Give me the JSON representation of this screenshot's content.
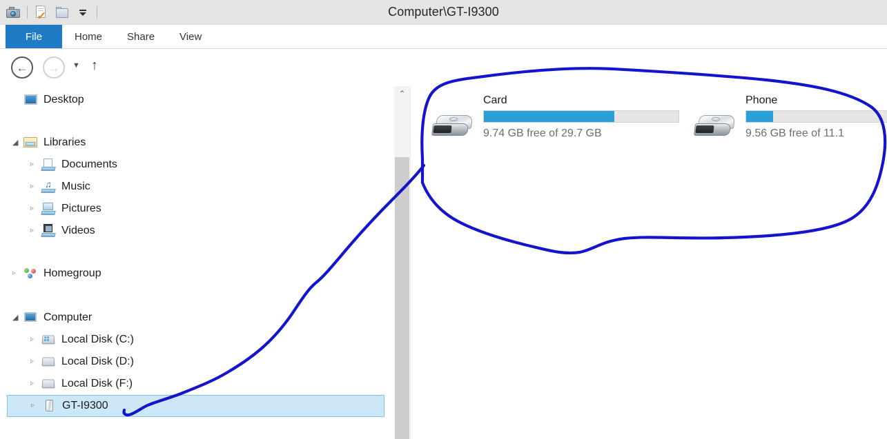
{
  "window": {
    "title": "Computer\\GT-I9300",
    "quick_access": [
      {
        "name": "device-camera-icon",
        "label": "GT-I9300"
      },
      {
        "name": "properties-icon",
        "label": "Properties"
      },
      {
        "name": "new-folder-icon",
        "label": "New folder"
      },
      {
        "name": "customize-dropdown-icon",
        "label": "Customize Quick Access Toolbar"
      }
    ]
  },
  "ribbon": {
    "tabs": [
      {
        "label": "File",
        "active": true
      },
      {
        "label": "Home",
        "active": false
      },
      {
        "label": "Share",
        "active": false
      },
      {
        "label": "View",
        "active": false
      }
    ]
  },
  "navigation": {
    "back_glyph": "←",
    "forward_glyph": "→",
    "history_glyph": "▼",
    "up_glyph": "↑",
    "breadcrumb": {
      "icon": "device-camera-icon",
      "separator": "▸",
      "items": [
        "Computer",
        "GT-I9300"
      ]
    }
  },
  "sidebar": {
    "items": [
      {
        "label": "Desktop",
        "icon": "desktop-icon",
        "indent": 1,
        "expander": "none",
        "selected": false
      },
      {
        "label": "Libraries",
        "icon": "libraries-icon",
        "indent": 1,
        "expander": "open",
        "selected": false
      },
      {
        "label": "Documents",
        "icon": "documents-icon",
        "indent": 2,
        "expander": "closed",
        "selected": false
      },
      {
        "label": "Music",
        "icon": "music-icon",
        "indent": 2,
        "expander": "closed",
        "selected": false
      },
      {
        "label": "Pictures",
        "icon": "pictures-icon",
        "indent": 2,
        "expander": "closed",
        "selected": false
      },
      {
        "label": "Videos",
        "icon": "videos-icon",
        "indent": 2,
        "expander": "closed",
        "selected": false
      },
      {
        "label": "Homegroup",
        "icon": "homegroup-icon",
        "indent": 1,
        "expander": "closed",
        "selected": false
      },
      {
        "label": "Computer",
        "icon": "computer-icon",
        "indent": 1,
        "expander": "open",
        "selected": false
      },
      {
        "label": "Local Disk (C:)",
        "icon": "disk-c-icon",
        "indent": 2,
        "expander": "closed",
        "selected": false
      },
      {
        "label": "Local Disk (D:)",
        "icon": "disk-d-icon",
        "indent": 2,
        "expander": "closed",
        "selected": false
      },
      {
        "label": "Local Disk (F:)",
        "icon": "disk-f-icon",
        "indent": 2,
        "expander": "closed",
        "selected": false
      },
      {
        "label": "GT-I9300",
        "icon": "phone-icon",
        "indent": 2,
        "expander": "closed",
        "selected": true
      }
    ],
    "expander_closed_glyph": "▹",
    "expander_open_glyph": "◢"
  },
  "scrollbar": {
    "up_arrow_glyph": "⌃"
  },
  "drives": [
    {
      "name": "Card",
      "free_text": "9.74 GB free of 29.7 GB",
      "used_percent": 67,
      "icon": "portable-drive-icon"
    },
    {
      "name": "Phone",
      "free_text": "9.56 GB free of 11.1",
      "used_percent": 14,
      "icon": "portable-drive-icon"
    }
  ],
  "colors": {
    "accent_blue": "#1f7bc4",
    "bar_fill": "#2a9fd8",
    "bar_track": "#e6e6e6",
    "selection": "#cce8f7",
    "annotation": "#1414cc"
  },
  "annotation": {
    "description": "hand-drawn blue circle around the Card and Phone drives with a line pointing to GT-I9300"
  }
}
